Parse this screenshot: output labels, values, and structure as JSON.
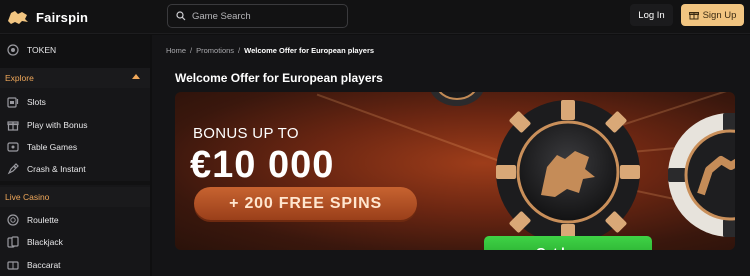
{
  "header": {
    "logo_text": "Fairspin",
    "search_placeholder": "Game Search",
    "login_label": "Log In",
    "signup_label": "Sign Up"
  },
  "sidebar": {
    "token_label": "TOKEN",
    "explore_title": "Explore",
    "explore_items": [
      {
        "label": "Slots",
        "icon": "slot-machine-icon"
      },
      {
        "label": "Play with Bonus",
        "icon": "gift-icon"
      },
      {
        "label": "Table Games",
        "icon": "table-games-icon"
      },
      {
        "label": "Crash & Instant",
        "icon": "rocket-icon"
      }
    ],
    "live_title": "Live Casino",
    "live_items": [
      {
        "label": "Roulette",
        "icon": "roulette-icon"
      },
      {
        "label": "Blackjack",
        "icon": "cards-icon"
      },
      {
        "label": "Baccarat",
        "icon": "baccarat-icon"
      }
    ]
  },
  "breadcrumb": {
    "home": "Home",
    "sep": "/",
    "promotions": "Promotions",
    "current": "Welcome Offer for European players"
  },
  "page": {
    "title": "Welcome Offer for European players"
  },
  "banner": {
    "bonus_up_to": "BONUS UP TO",
    "amount": "€10 000",
    "spins": "+ 200 FREE SPINS",
    "cta": "Get bonus"
  },
  "colors": {
    "accent": "#f2c581",
    "section_title": "#f0a85a",
    "cta_green": "#2fbf36"
  }
}
